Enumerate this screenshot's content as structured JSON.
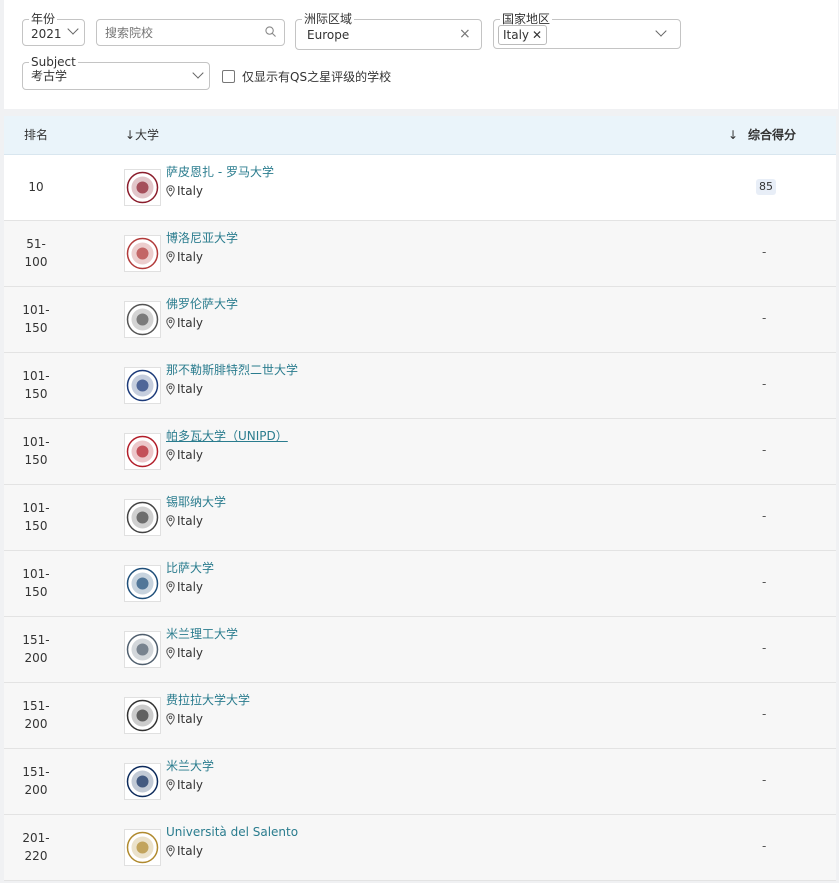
{
  "filters": {
    "year": {
      "label": "年份",
      "value": "2021"
    },
    "search": {
      "placeholder": "搜索院校"
    },
    "region": {
      "label": "洲际区域",
      "value": "Europe"
    },
    "country": {
      "label": "国家地区",
      "chip": "Italy"
    },
    "subject": {
      "label": "Subject",
      "value": "考古学"
    },
    "qs_stars_only": {
      "label": "仅显示有QS之星评级的学校",
      "checked": false
    }
  },
  "table": {
    "headers": {
      "rank": "排名",
      "university": "↓大学",
      "score": "综合得分"
    },
    "rows": [
      {
        "rank": "10",
        "name": "萨皮恩扎 - 罗马大学",
        "location": "Italy",
        "score": "85",
        "logo_color": "#8b1d2c"
      },
      {
        "rank": "51-\n100",
        "name": "博洛尼亚大学",
        "location": "Italy",
        "score": "-",
        "logo_color": "#b23b3b"
      },
      {
        "rank": "101-\n150",
        "name": "佛罗伦萨大学",
        "location": "Italy",
        "score": "-",
        "logo_color": "#555555"
      },
      {
        "rank": "101-\n150",
        "name": "那不勒斯腓特烈二世大学",
        "location": "Italy",
        "score": "-",
        "logo_color": "#1d3b7a"
      },
      {
        "rank": "101-\n150",
        "name": "帕多瓦大学（UNIPD）",
        "location": "Italy",
        "score": "-",
        "logo_color": "#b21e2a",
        "underlined": true
      },
      {
        "rank": "101-\n150",
        "name": "锡耶纳大学",
        "location": "Italy",
        "score": "-",
        "logo_color": "#444444"
      },
      {
        "rank": "101-\n150",
        "name": "比萨大学",
        "location": "Italy",
        "score": "-",
        "logo_color": "#1f4f7a"
      },
      {
        "rank": "151-\n200",
        "name": "米兰理工大学",
        "location": "Italy",
        "score": "-",
        "logo_color": "#51606f"
      },
      {
        "rank": "151-\n200",
        "name": "费拉拉大学大学",
        "location": "Italy",
        "score": "-",
        "logo_color": "#333333"
      },
      {
        "rank": "151-\n200",
        "name": "米兰大学",
        "location": "Italy",
        "score": "-",
        "logo_color": "#0d2b5c"
      },
      {
        "rank": "201-\n220",
        "name": "Università del Salento",
        "location": "Italy",
        "score": "-",
        "logo_color": "#b08a2e"
      }
    ]
  },
  "colors": {
    "link": "#2a7c8e",
    "header_bg": "#eaf4fa",
    "score_bg": "#e8eef7"
  }
}
